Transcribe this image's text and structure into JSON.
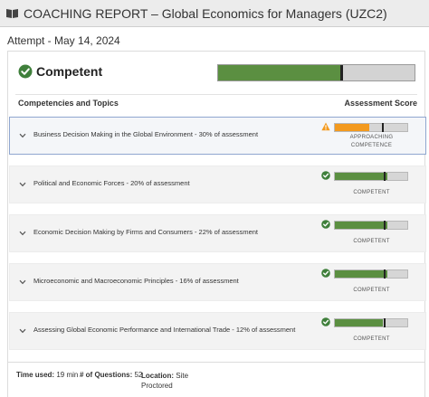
{
  "header": {
    "title": "COACHING REPORT – Global Economics for Managers (UZC2)",
    "icon": "book-icon"
  },
  "attempt": "Attempt - May 14, 2024",
  "overall": {
    "label": "Competent",
    "icon": "check-circle-icon",
    "score_fraction": 0.63,
    "marker_fraction": 0.62
  },
  "columns": {
    "left": "Competencies and Topics",
    "right": "Assessment Score"
  },
  "colors": {
    "competent": "#5b8f41",
    "approaching": "#f39a1f",
    "check": "#3f7f3b",
    "warning": "#f39a1f"
  },
  "rows": [
    {
      "label": "Business Decision Making in the Global Environment - 30% of assessment",
      "status_line1": "APPROACHING",
      "status_line2": "COMPETENCE",
      "status_icon": "warning-icon",
      "fill_fraction": 0.48,
      "marker_fraction": 0.65,
      "level": "approaching"
    },
    {
      "label": "Political and Economic Forces - 20% of assessment",
      "status_line1": "COMPETENT",
      "status_line2": "",
      "status_icon": "check-circle-icon",
      "fill_fraction": 0.72,
      "marker_fraction": 0.67,
      "level": "competent"
    },
    {
      "label": "Economic Decision Making by Firms and Consumers - 22% of assessment",
      "status_line1": "COMPETENT",
      "status_line2": "",
      "status_icon": "check-circle-icon",
      "fill_fraction": 0.72,
      "marker_fraction": 0.67,
      "level": "competent"
    },
    {
      "label": "Microeconomic and Macroeconomic Principles - 16% of assessment",
      "status_line1": "COMPETENT",
      "status_line2": "",
      "status_icon": "check-circle-icon",
      "fill_fraction": 0.72,
      "marker_fraction": 0.67,
      "level": "competent"
    },
    {
      "label": "Assessing Global Economic Performance and International Trade - 12% of assessment",
      "status_line1": "COMPETENT",
      "status_line2": "",
      "status_icon": "check-circle-icon",
      "fill_fraction": 0.66,
      "marker_fraction": 0.67,
      "level": "competent"
    }
  ],
  "footer": {
    "time_label": "Time used:",
    "time_value": "19 min",
    "questions_label": "# of Questions:",
    "questions_value": "52",
    "location_label": "Location:",
    "location_value": "Site Proctored"
  }
}
